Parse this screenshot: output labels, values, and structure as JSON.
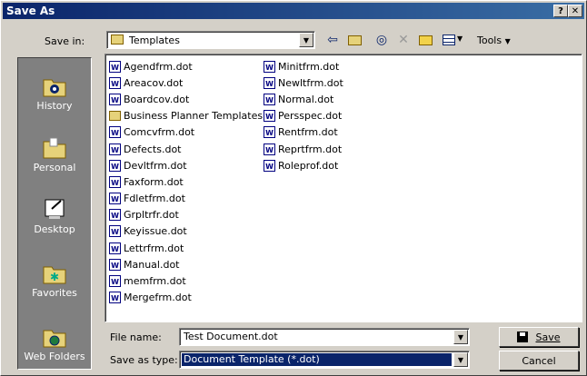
{
  "window": {
    "title": "Save As",
    "help_label": "?",
    "close_label": "✕"
  },
  "savein": {
    "label": "Save in:",
    "value": "Templates"
  },
  "toolbar": {
    "tools_label": "Tools",
    "back_icon": "back-arrow-icon",
    "up_icon": "folder-up-icon",
    "search_icon": "search-web-icon",
    "delete_icon": "delete-icon",
    "newfolder_icon": "new-folder-icon",
    "views_icon": "views-icon"
  },
  "places": [
    {
      "label": "History",
      "icon": "history-icon"
    },
    {
      "label": "Personal",
      "icon": "personal-folder-icon"
    },
    {
      "label": "Desktop",
      "icon": "desktop-icon"
    },
    {
      "label": "Favorites",
      "icon": "favorites-icon"
    },
    {
      "label": "Web Folders",
      "icon": "web-folders-icon"
    }
  ],
  "files_col1": [
    {
      "name": "Agendfrm.dot",
      "type": "doc"
    },
    {
      "name": "Areacov.dot",
      "type": "doc"
    },
    {
      "name": "Boardcov.dot",
      "type": "doc"
    },
    {
      "name": "Business Planner Templates",
      "type": "folder"
    },
    {
      "name": "Comcvfrm.dot",
      "type": "doc"
    },
    {
      "name": "Defects.dot",
      "type": "doc"
    },
    {
      "name": "Devltfrm.dot",
      "type": "doc"
    },
    {
      "name": "Faxform.dot",
      "type": "doc"
    },
    {
      "name": "Fdletfrm.dot",
      "type": "doc"
    },
    {
      "name": "Grpltrfr.dot",
      "type": "doc"
    },
    {
      "name": "Keyissue.dot",
      "type": "doc"
    },
    {
      "name": "Lettrfrm.dot",
      "type": "doc"
    },
    {
      "name": "Manual.dot",
      "type": "doc"
    },
    {
      "name": "memfrm.dot",
      "type": "doc"
    },
    {
      "name": "Mergefrm.dot",
      "type": "doc"
    }
  ],
  "files_col2": [
    {
      "name": "Minitfrm.dot",
      "type": "doc"
    },
    {
      "name": "Newltfrm.dot",
      "type": "doc"
    },
    {
      "name": "Normal.dot",
      "type": "doc"
    },
    {
      "name": "Persspec.dot",
      "type": "doc"
    },
    {
      "name": "Rentfrm.dot",
      "type": "doc"
    },
    {
      "name": "Reprtfrm.dot",
      "type": "doc"
    },
    {
      "name": "Roleprof.dot",
      "type": "doc"
    }
  ],
  "filename": {
    "label": "File name:",
    "value": "Test Document.dot"
  },
  "savetype": {
    "label": "Save as type:",
    "value": "Document Template (*.dot)"
  },
  "buttons": {
    "save": "Save",
    "cancel": "Cancel"
  },
  "colors": {
    "title_bar": "#0a246a",
    "selection": "#0a246a",
    "dialog_bg": "#d4d0c8",
    "sidebar_bg": "#808080"
  }
}
